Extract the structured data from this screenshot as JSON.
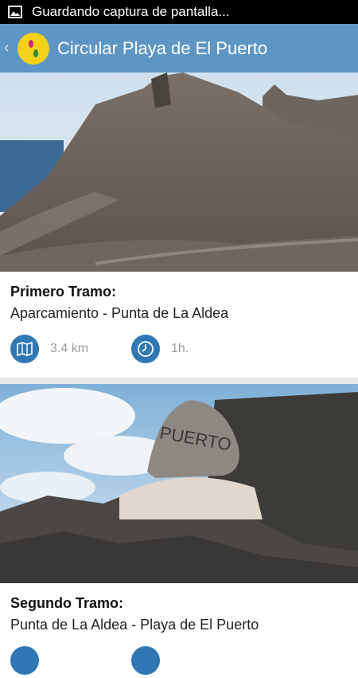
{
  "status_bar": {
    "notification_text": "Guardando captura de pantalla..."
  },
  "app_bar": {
    "title": "Circular Playa de El Puerto"
  },
  "sections": [
    {
      "title": "Primero Tramo:",
      "route": "Aparcamiento - Punta de La Aldea",
      "distance": "3.4 km",
      "duration": "1h.",
      "distance_icon": "map-icon",
      "duration_icon": "clock-icon"
    },
    {
      "title": "Segundo Tramo:",
      "route": "Punta de La Aldea - Playa de El Puerto",
      "distance": "",
      "duration": "",
      "distance_icon": "map-icon",
      "duration_icon": "clock-icon"
    }
  ],
  "photo_text": "PUERTO",
  "colors": {
    "app_bar": "#5d96c4",
    "icon_circle": "#2f78b3",
    "logo": "#f4d21a"
  }
}
